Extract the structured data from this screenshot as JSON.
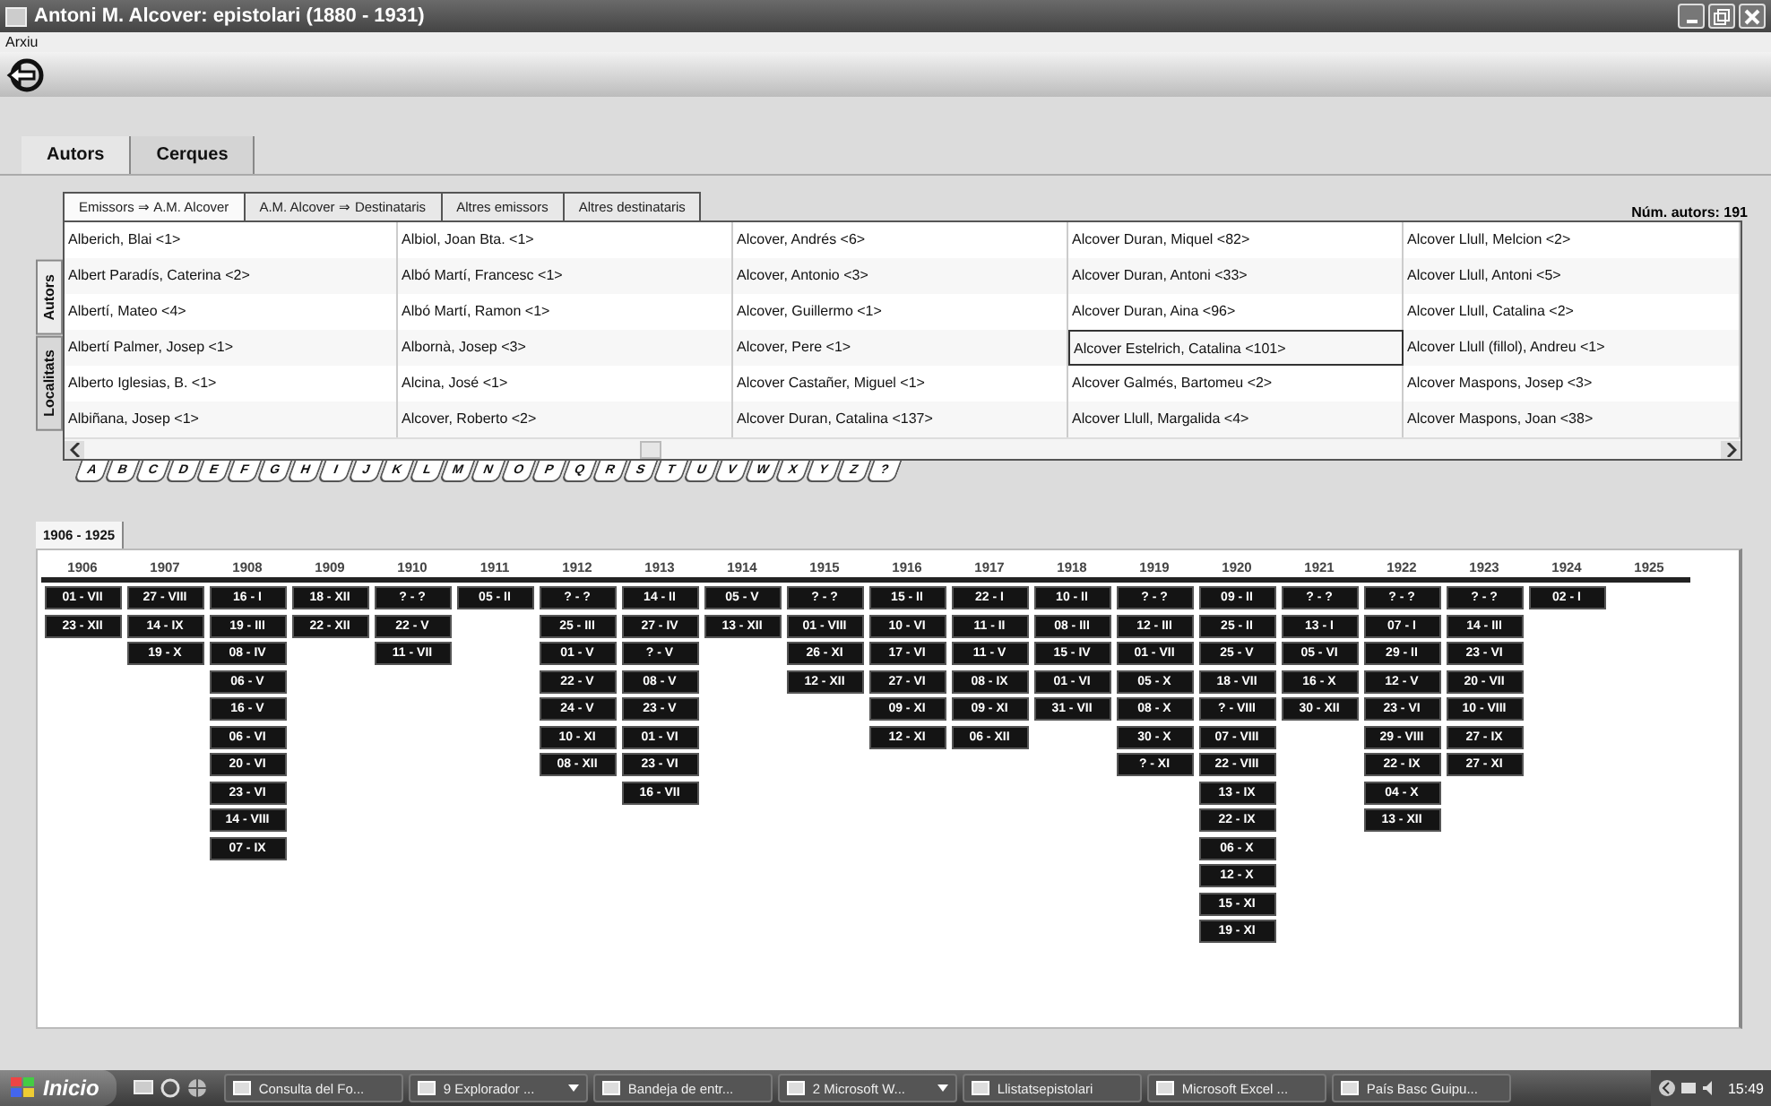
{
  "window": {
    "title": "Antoni M. Alcover: epistolari (1880 - 1931)"
  },
  "menu": [
    "Arxiu"
  ],
  "tabs": [
    {
      "label": "Autors",
      "selected": true
    },
    {
      "label": "Cerques",
      "selected": false
    }
  ],
  "subtabs": [
    {
      "label": "Emissors ⇒ A.M. Alcover",
      "selected": true
    },
    {
      "label": "A.M. Alcover ⇒ Destinataris",
      "selected": false
    },
    {
      "label": "Altres emissors",
      "selected": false
    },
    {
      "label": "Altres destinataris",
      "selected": false
    }
  ],
  "count": "Núm. autors: 191",
  "side_tabs": [
    {
      "label": "Autors",
      "selected": true
    },
    {
      "label": "Localitats",
      "selected": false
    }
  ],
  "authors": [
    [
      {
        "text": "Alberich, Blai <1>",
        "selected": false
      },
      {
        "text": "Albiol, Joan Bta. <1>",
        "selected": false
      },
      {
        "text": "Alcover, Andrés <6>",
        "selected": false
      },
      {
        "text": "Alcover Duran, Miquel <82>",
        "selected": false
      },
      {
        "text": "Alcover Llull, Melcion <2>",
        "selected": false
      }
    ],
    [
      {
        "text": "Albert Paradís, Caterina <2>",
        "selected": false
      },
      {
        "text": "Albó Martí, Francesc <1>",
        "selected": false
      },
      {
        "text": "Alcover, Antonio <3>",
        "selected": false
      },
      {
        "text": "Alcover Duran, Antoni <33>",
        "selected": false
      },
      {
        "text": "Alcover Llull, Antoni <5>",
        "selected": false
      }
    ],
    [
      {
        "text": "Albertí, Mateo <4>",
        "selected": false
      },
      {
        "text": "Albó Martí, Ramon <1>",
        "selected": false
      },
      {
        "text": "Alcover, Guillermo <1>",
        "selected": false
      },
      {
        "text": "Alcover Duran, Aina <96>",
        "selected": false
      },
      {
        "text": "Alcover Llull, Catalina <2>",
        "selected": false
      }
    ],
    [
      {
        "text": "Albertí Palmer, Josep <1>",
        "selected": false
      },
      {
        "text": "Albornà, Josep <3>",
        "selected": false
      },
      {
        "text": "Alcover, Pere <1>",
        "selected": false
      },
      {
        "text": "Alcover Estelrich, Catalina <101>",
        "selected": true
      },
      {
        "text": "Alcover Llull (fillol), Andreu <1>",
        "selected": false
      }
    ],
    [
      {
        "text": "Alberto Iglesias, B. <1>",
        "selected": false
      },
      {
        "text": "Alcina, José <1>",
        "selected": false
      },
      {
        "text": "Alcover Castañer, Miguel <1>",
        "selected": false
      },
      {
        "text": "Alcover Galmés, Bartomeu <2>",
        "selected": false
      },
      {
        "text": "Alcover Maspons, Josep <3>",
        "selected": false
      }
    ],
    [
      {
        "text": "Albiñana, Josep <1>",
        "selected": false
      },
      {
        "text": "Alcover, Roberto <2>",
        "selected": false
      },
      {
        "text": "Alcover Duran, Catalina <137>",
        "selected": false
      },
      {
        "text": "Alcover Llull, Margalida <4>",
        "selected": false
      },
      {
        "text": "Alcover Maspons, Joan <38>",
        "selected": false
      }
    ]
  ],
  "letters": [
    "A",
    "B",
    "C",
    "D",
    "E",
    "F",
    "G",
    "H",
    "I",
    "J",
    "K",
    "L",
    "M",
    "N",
    "O",
    "P",
    "Q",
    "R",
    "S",
    "T",
    "U",
    "V",
    "W",
    "X",
    "Y",
    "Z",
    "?"
  ],
  "period_tab": "1906 - 1925",
  "timeline": [
    {
      "year": "1906",
      "letters": [
        "01 - VII",
        "23 - XII"
      ]
    },
    {
      "year": "1907",
      "letters": [
        "27 - VIII",
        "14 - IX",
        "19 - X"
      ]
    },
    {
      "year": "1908",
      "letters": [
        "16 - I",
        "19 - III",
        "08 - IV",
        "06 - V",
        "16 - V",
        "06 - VI",
        "20 - VI",
        "23 - VI",
        "14 - VIII",
        "07 - IX"
      ]
    },
    {
      "year": "1909",
      "letters": [
        "18 - XII",
        "22 - XII"
      ]
    },
    {
      "year": "1910",
      "letters": [
        "? - ?",
        "22 - V",
        "11 - VII"
      ]
    },
    {
      "year": "1911",
      "letters": [
        "05 - II"
      ]
    },
    {
      "year": "1912",
      "letters": [
        "? - ?",
        "25 - III",
        "01 - V",
        "22 - V",
        "24 - V",
        "10 - XI",
        "08 - XII"
      ]
    },
    {
      "year": "1913",
      "letters": [
        "14 - II",
        "27 - IV",
        "? - V",
        "08 - V",
        "23 - V",
        "01 - VI",
        "23 - VI",
        "16 - VII"
      ]
    },
    {
      "year": "1914",
      "letters": [
        "05 - V",
        "13 - XII"
      ]
    },
    {
      "year": "1915",
      "letters": [
        "? - ?",
        "01 - VIII",
        "26 - XI",
        "12 - XII"
      ]
    },
    {
      "year": "1916",
      "letters": [
        "15 - II",
        "10 - VI",
        "17 - VI",
        "27 - VI",
        "09 - XI",
        "12 - XI"
      ]
    },
    {
      "year": "1917",
      "letters": [
        "22 - I",
        "11 - II",
        "11 - V",
        "08 - IX",
        "09 - XI",
        "06 - XII"
      ]
    },
    {
      "year": "1918",
      "letters": [
        "10 - II",
        "08 - III",
        "15 - IV",
        "01 - VI",
        "31 - VII"
      ]
    },
    {
      "year": "1919",
      "letters": [
        "? - ?",
        "12 - III",
        "01 - VII",
        "05 - X",
        "08 - X",
        "30 - X",
        "? - XI"
      ]
    },
    {
      "year": "1920",
      "letters": [
        "09 - II",
        "25 - II",
        "25 - V",
        "18 - VII",
        "? - VIII",
        "07 - VIII",
        "22 - VIII",
        "13 - IX",
        "22 - IX",
        "06 - X",
        "12 - X",
        "15 - XI",
        "19 - XI"
      ]
    },
    {
      "year": "1921",
      "letters": [
        "? - ?",
        "13 - I",
        "05 - VI",
        "16 - X",
        "30 - XII"
      ]
    },
    {
      "year": "1922",
      "letters": [
        "? - ?",
        "07 - I",
        "29 - II",
        "12 - V",
        "23 - VI",
        "29 - VIII",
        "22 - IX",
        "04 - X",
        "13 - XII"
      ]
    },
    {
      "year": "1923",
      "letters": [
        "? - ?",
        "14 - III",
        "23 - VI",
        "20 - VII",
        "10 - VIII",
        "27 - IX",
        "27 - XI"
      ]
    },
    {
      "year": "1924",
      "letters": [
        "02 - I"
      ]
    },
    {
      "year": "1925"
    }
  ],
  "taskbar": {
    "start": "Inicio",
    "tasks": [
      {
        "label": "Consulta del Fo...",
        "group": false
      },
      {
        "label": "9 Explorador ...",
        "group": true
      },
      {
        "label": "Bandeja de entr...",
        "group": false
      },
      {
        "label": "2 Microsoft W...",
        "group": true
      },
      {
        "label": "Llistatsepistolari",
        "group": false
      },
      {
        "label": "Microsoft Excel ...",
        "group": false
      },
      {
        "label": "País Basc Guipu...",
        "group": false
      }
    ],
    "clock": "15:49"
  }
}
